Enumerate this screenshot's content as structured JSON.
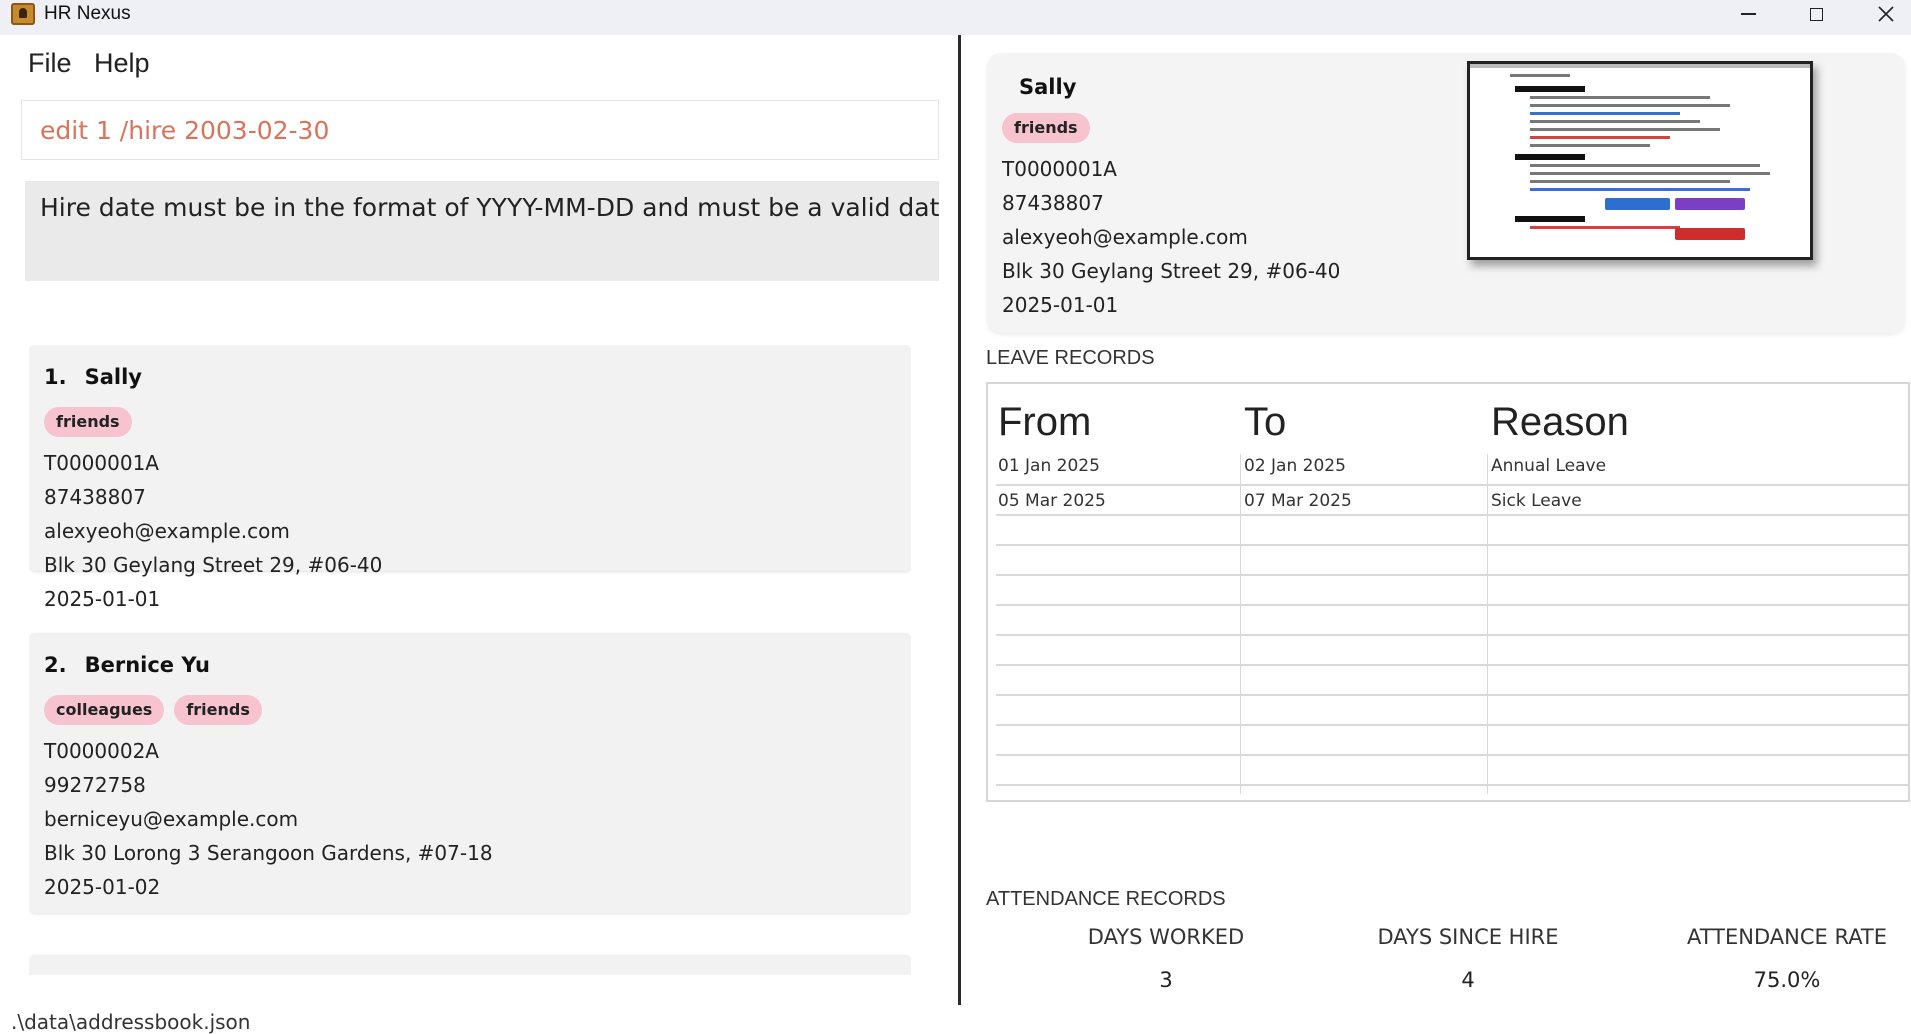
{
  "window": {
    "title": "HR Nexus",
    "controls": [
      "minimize-icon",
      "maximize-icon",
      "close-icon"
    ]
  },
  "menu": {
    "file": "File",
    "help": "Help"
  },
  "command": {
    "value": "edit 1 /hire 2003-02-30"
  },
  "result": {
    "message": "Hire date must be in the format of YYYY-MM-DD and must be a valid date (betwee"
  },
  "persons": [
    {
      "index": "1.",
      "name": "Sally",
      "tags": [
        "friends"
      ],
      "id": "T0000001A",
      "phone": "87438807",
      "email": "alexyeoh@example.com",
      "address": "Blk 30 Geylang Street 29, #06-40",
      "hire_date": "2025-01-01"
    },
    {
      "index": "2.",
      "name": "Bernice Yu",
      "tags": [
        "colleagues",
        "friends"
      ],
      "id": "T0000002A",
      "phone": "99272758",
      "email": "berniceyu@example.com",
      "address": "Blk 30 Lorong 3 Serangoon Gardens, #07-18",
      "hire_date": "2025-01-02"
    }
  ],
  "status_bar": {
    "path": ".\\data\\addressbook.json"
  },
  "profile": {
    "name": "Sally",
    "tag": "friends",
    "id": "T0000001A",
    "phone": "87438807",
    "email": "alexyeoh@example.com",
    "address": "Blk 30 Geylang Street 29, #06-40",
    "hire_date": "2025-01-01"
  },
  "leave": {
    "title": "LEAVE RECORDS",
    "headers": [
      "From",
      "To",
      "Reason"
    ],
    "rows": [
      [
        "01 Jan 2025",
        "02 Jan 2025",
        "Annual Leave"
      ],
      [
        "05 Mar 2025",
        "07 Mar 2025",
        "Sick Leave"
      ]
    ]
  },
  "attendance": {
    "title": "ATTENDANCE RECORDS",
    "labels": [
      "DAYS WORKED",
      "DAYS SINCE HIRE",
      "ATTENDANCE RATE"
    ],
    "values": [
      "3",
      "4",
      "75.0%"
    ]
  }
}
